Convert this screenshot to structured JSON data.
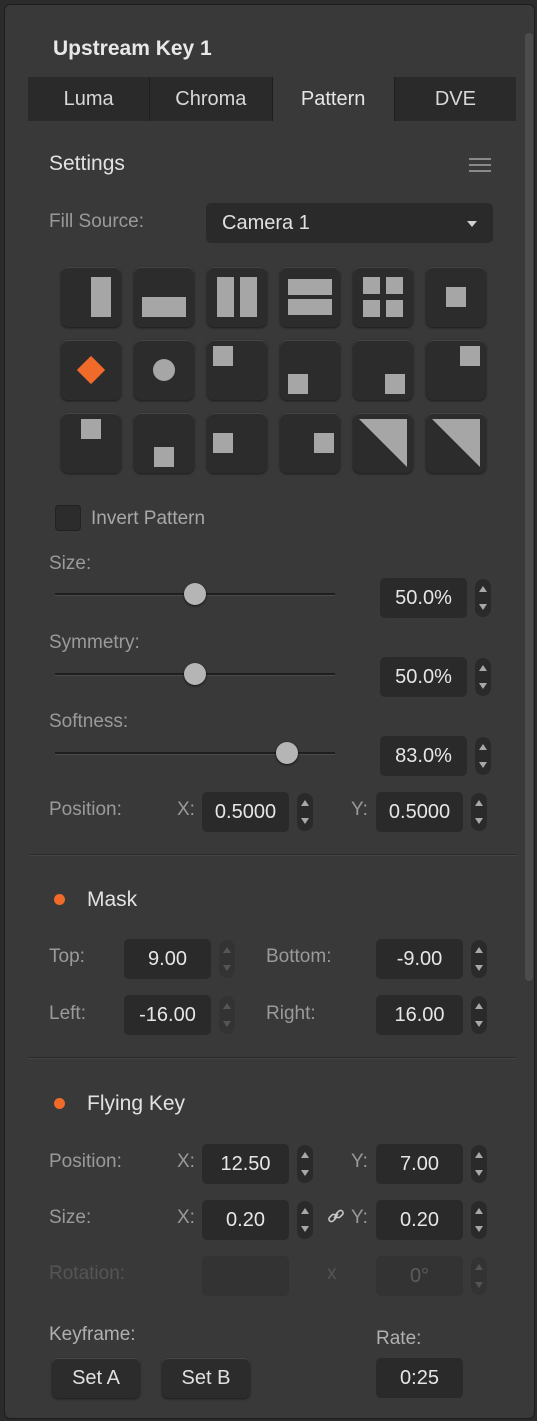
{
  "panel": {
    "title": "Upstream Key 1"
  },
  "tabs": [
    {
      "label": "Luma",
      "active": false
    },
    {
      "label": "Chroma",
      "active": false
    },
    {
      "label": "Pattern",
      "active": true
    },
    {
      "label": "DVE",
      "active": false
    }
  ],
  "settings": {
    "title": "Settings",
    "fill_source_label": "Fill Source:",
    "fill_source_value": "Camera 1",
    "patterns": [
      "vertical-bar",
      "horizontal-bar",
      "vertical-split",
      "horizontal-split",
      "four-box",
      "small-square",
      "diamond",
      "circle",
      "top-left-box",
      "bottom-left-box",
      "bottom-right-box",
      "top-right-box",
      "top-center-box",
      "bottom-center-box",
      "left-center-box",
      "right-center-box",
      "top-left-diagonal",
      "top-right-diagonal"
    ],
    "selected_pattern": "diamond",
    "invert_label": "Invert Pattern",
    "invert_checked": false,
    "size_label": "Size:",
    "size_value": "50.0%",
    "size_level": 0.5,
    "symmetry_label": "Symmetry:",
    "symmetry_value": "50.0%",
    "symmetry_level": 0.5,
    "softness_label": "Softness:",
    "softness_value": "83.0%",
    "softness_level": 0.83,
    "position_label": "Position:",
    "x_label": "X:",
    "x_value": "0.5000",
    "y_label": "Y:",
    "y_value": "0.5000"
  },
  "mask": {
    "title": "Mask",
    "enabled_color": "#f06a2a",
    "top_label": "Top:",
    "top_value": "9.00",
    "bottom_label": "Bottom:",
    "bottom_value": "-9.00",
    "left_label": "Left:",
    "left_value": "-16.00",
    "right_label": "Right:",
    "right_value": "16.00"
  },
  "flying_key": {
    "title": "Flying Key",
    "enabled_color": "#f06a2a",
    "position_label": "Position:",
    "pos_x_label": "X:",
    "pos_x_value": "12.50",
    "pos_y_label": "Y:",
    "pos_y_value": "7.00",
    "size_label": "Size:",
    "size_x_label": "X:",
    "size_x_value": "0.20",
    "size_y_label": "Y:",
    "size_y_value": "0.20",
    "rotation_label": "Rotation:",
    "rotation_x": "x",
    "rotation_value": "0°",
    "keyframe_label": "Keyframe:",
    "set_a_label": "Set A",
    "set_b_label": "Set B",
    "rate_label": "Rate:",
    "rate_value": "0:25"
  }
}
